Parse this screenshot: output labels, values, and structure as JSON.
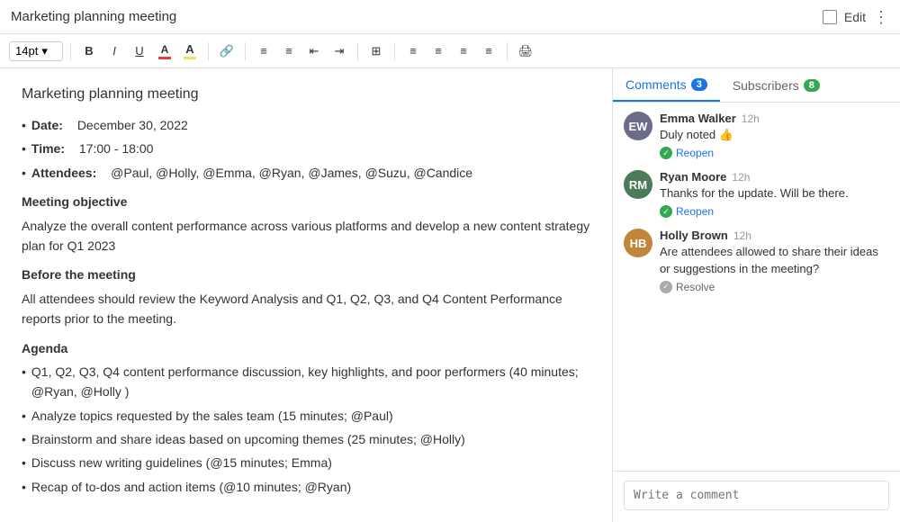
{
  "header": {
    "title": "Marketing planning meeting",
    "edit_label": "Edit"
  },
  "toolbar": {
    "font_size": "14pt",
    "chevron": "▾"
  },
  "document": {
    "title": "Marketing planning meeting",
    "items": [
      {
        "label": "Date:",
        "value": "December 30, 2022"
      },
      {
        "label": "Time:",
        "value": "17:00 - 18:00"
      },
      {
        "label": "Attendees:",
        "value": "@Paul, @Holly, @Emma, @Ryan, @James, @Suzu, @Candice"
      }
    ],
    "meeting_objective_heading": "Meeting objective",
    "meeting_objective_text": "Analyze the overall content performance across various platforms and develop a new content strategy plan for Q1 2023",
    "before_heading": "Before the meeting",
    "before_text": "All attendees should review the Keyword Analysis and Q1, Q2, Q3, and Q4 Content Performance reports prior to the meeting.",
    "agenda_heading": "Agenda",
    "agenda_items": [
      "Q1, Q2, Q3, Q4 content performance discussion, key highlights, and poor performers (40 minutes; @Ryan, @Holly )",
      "Analyze topics requested by the sales team (15 minutes; @Paul)",
      "Brainstorm and share ideas based on upcoming themes (25 minutes; @Holly)",
      "Discuss new writing guidelines (@15 minutes; Emma)",
      "Recap of to-dos and action items (@10 minutes; @Ryan)"
    ]
  },
  "tabs": {
    "comments_label": "Comments",
    "comments_badge": "3",
    "subscribers_label": "Subscribers",
    "subscribers_badge": "8"
  },
  "comments": [
    {
      "author": "Emma Walker",
      "time": "12h",
      "text": "Duly noted 👍",
      "action": "Reopen",
      "action_type": "reopen",
      "avatar_initials": "EW",
      "avatar_class": "avatar-emma"
    },
    {
      "author": "Ryan Moore",
      "time": "12h",
      "text": "Thanks for the update. Will be there.",
      "action": "Reopen",
      "action_type": "reopen",
      "avatar_initials": "RM",
      "avatar_class": "avatar-ryan"
    },
    {
      "author": "Holly Brown",
      "time": "12h",
      "text": "Are attendees allowed to share their ideas or suggestions in the meeting?",
      "action": "Resolve",
      "action_type": "resolve",
      "avatar_initials": "HB",
      "avatar_class": "avatar-holly"
    }
  ],
  "comment_input": {
    "placeholder": "Write a comment"
  }
}
